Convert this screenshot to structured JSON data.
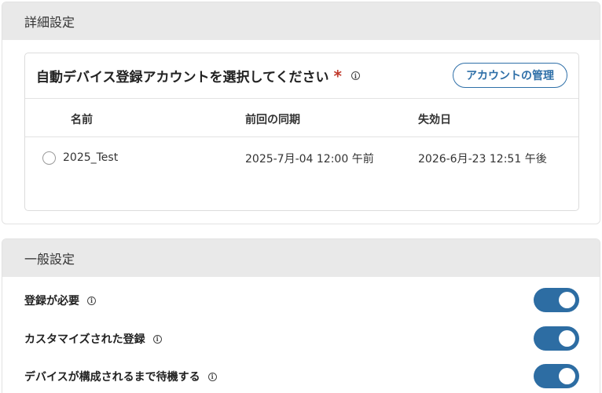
{
  "advanced": {
    "header": "詳細設定",
    "card": {
      "title": "自動デバイス登録アカウントを選択してください",
      "required_mark": "*",
      "info_icon": "info-icon",
      "manage_button": "アカウントの管理",
      "columns": [
        "名前",
        "前回の同期",
        "失効日"
      ],
      "rows": [
        {
          "selected": false,
          "name": "2025_Test",
          "last_sync": "2025-7月-04 12:00 午前",
          "expiry": "2026-6月-23 12:51 午後"
        }
      ]
    }
  },
  "general": {
    "header": "一般設定",
    "settings": [
      {
        "label": "登録が必要",
        "enabled": true
      },
      {
        "label": "カスタマイズされた登録",
        "enabled": true
      },
      {
        "label": "デバイスが構成されるまで待機する",
        "enabled": true
      }
    ]
  },
  "colors": {
    "accent": "#2e6fa8",
    "toggle_on": "#2d6da3",
    "required": "#c0392b",
    "header_bg": "#e9e9e9"
  }
}
